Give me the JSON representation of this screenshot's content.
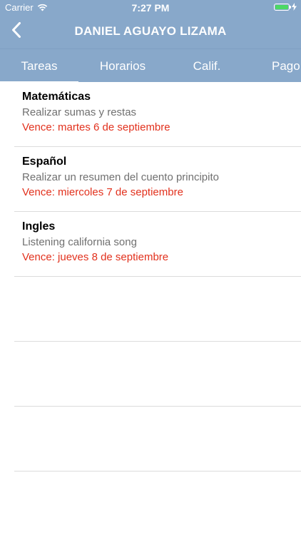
{
  "status_bar": {
    "carrier": "Carrier",
    "time": "7:27 PM",
    "icons": [
      "wifi-icon",
      "battery-icon",
      "charging-icon"
    ],
    "battery_color": "#4cd964"
  },
  "nav": {
    "title": "DANIEL AGUAYO LIZAMA",
    "back_icon": "chevron-left-icon"
  },
  "tabs": [
    {
      "label": "Tareas",
      "selected": true
    },
    {
      "label": "Horarios",
      "selected": false
    },
    {
      "label": "Calif.",
      "selected": false
    },
    {
      "label": "Pago",
      "selected": false
    }
  ],
  "tasks": [
    {
      "subject": "Matemáticas",
      "description": "Realizar sumas y restas",
      "due": "Vence: martes 6 de septiembre"
    },
    {
      "subject": "Español",
      "description": "Realizar un resumen del cuento principito",
      "due": "Vence: miercoles 7 de septiembre"
    },
    {
      "subject": "Ingles",
      "description": "Listening california song",
      "due": "Vence: jueves 8 de septiembre"
    }
  ],
  "colors": {
    "header_background": "#88a8ca",
    "due_text": "#e2311d",
    "description_text": "#707070"
  }
}
